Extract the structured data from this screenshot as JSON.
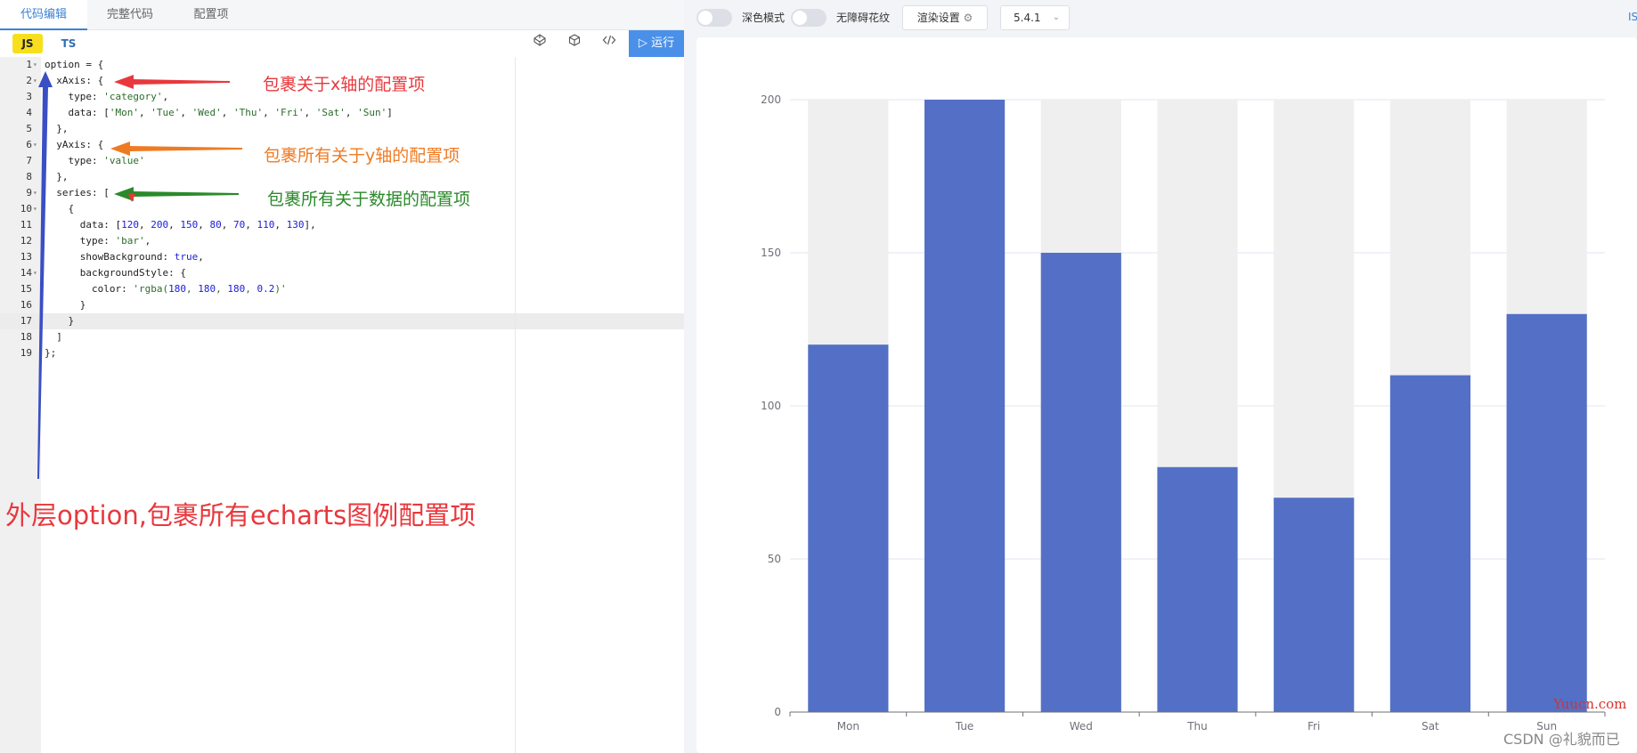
{
  "tabs": [
    {
      "label": "代码编辑",
      "active": true
    },
    {
      "label": "完整代码",
      "active": false
    },
    {
      "label": "配置项",
      "active": false
    }
  ],
  "toolbar": {
    "js_label": "JS",
    "ts_label": "TS",
    "run_label": "运行",
    "icons": [
      "codepen-icon",
      "codesandbox-icon",
      "format-code-icon"
    ]
  },
  "code_lines": [
    {
      "n": "1",
      "fold": true,
      "text": "option = {"
    },
    {
      "n": "2",
      "fold": true,
      "text": "  xAxis: {"
    },
    {
      "n": "3",
      "fold": false,
      "text": "    type: 'category',"
    },
    {
      "n": "4",
      "fold": false,
      "text": "    data: ['Mon', 'Tue', 'Wed', 'Thu', 'Fri', 'Sat', 'Sun']"
    },
    {
      "n": "5",
      "fold": false,
      "text": "  },"
    },
    {
      "n": "6",
      "fold": true,
      "text": "  yAxis: {"
    },
    {
      "n": "7",
      "fold": false,
      "text": "    type: 'value'"
    },
    {
      "n": "8",
      "fold": false,
      "text": "  },"
    },
    {
      "n": "9",
      "fold": true,
      "text": "  series: ["
    },
    {
      "n": "10",
      "fold": true,
      "text": "    {"
    },
    {
      "n": "11",
      "fold": false,
      "text": "      data: [120, 200, 150, 80, 70, 110, 130],"
    },
    {
      "n": "12",
      "fold": false,
      "text": "      type: 'bar',"
    },
    {
      "n": "13",
      "fold": false,
      "text": "      showBackground: true,"
    },
    {
      "n": "14",
      "fold": true,
      "text": "      backgroundStyle: {"
    },
    {
      "n": "15",
      "fold": false,
      "text": "        color: 'rgba(180, 180, 180, 0.2)'"
    },
    {
      "n": "16",
      "fold": false,
      "text": "      }"
    },
    {
      "n": "17",
      "fold": false,
      "text": "    }"
    },
    {
      "n": "18",
      "fold": false,
      "text": "  ]"
    },
    {
      "n": "19",
      "fold": false,
      "text": "};"
    }
  ],
  "annotations": {
    "x_axis": "包裹关于x轴的配置项",
    "y_axis": "包裹所有关于y轴的配置项",
    "series": "包裹所有关于数据的配置项",
    "outer": "外层option,包裹所有echarts图例配置项"
  },
  "annotation_colors": {
    "red": "#e8383d",
    "orange": "#ee7b24",
    "green": "#2a8a2a",
    "blue": "#3a4fc4"
  },
  "right_bar": {
    "dark_mode_label": "深色模式",
    "a11y_label": "无障碍花纹",
    "render_label": "渲染设置",
    "version": "5.4.1",
    "edge_text": "IS"
  },
  "chart_data": {
    "type": "bar",
    "categories": [
      "Mon",
      "Tue",
      "Wed",
      "Thu",
      "Fri",
      "Sat",
      "Sun"
    ],
    "values": [
      120,
      200,
      150,
      80,
      70,
      110,
      130
    ],
    "ylim": [
      0,
      200
    ],
    "yticks": [
      0,
      50,
      100,
      150,
      200
    ],
    "bar_color": "#5470c6",
    "background_color": "#efefef",
    "grid": true,
    "title": "",
    "xlabel": "",
    "ylabel": ""
  },
  "watermark": {
    "site": "Yuucn.com",
    "author": "CSDN @礼貌而已"
  }
}
